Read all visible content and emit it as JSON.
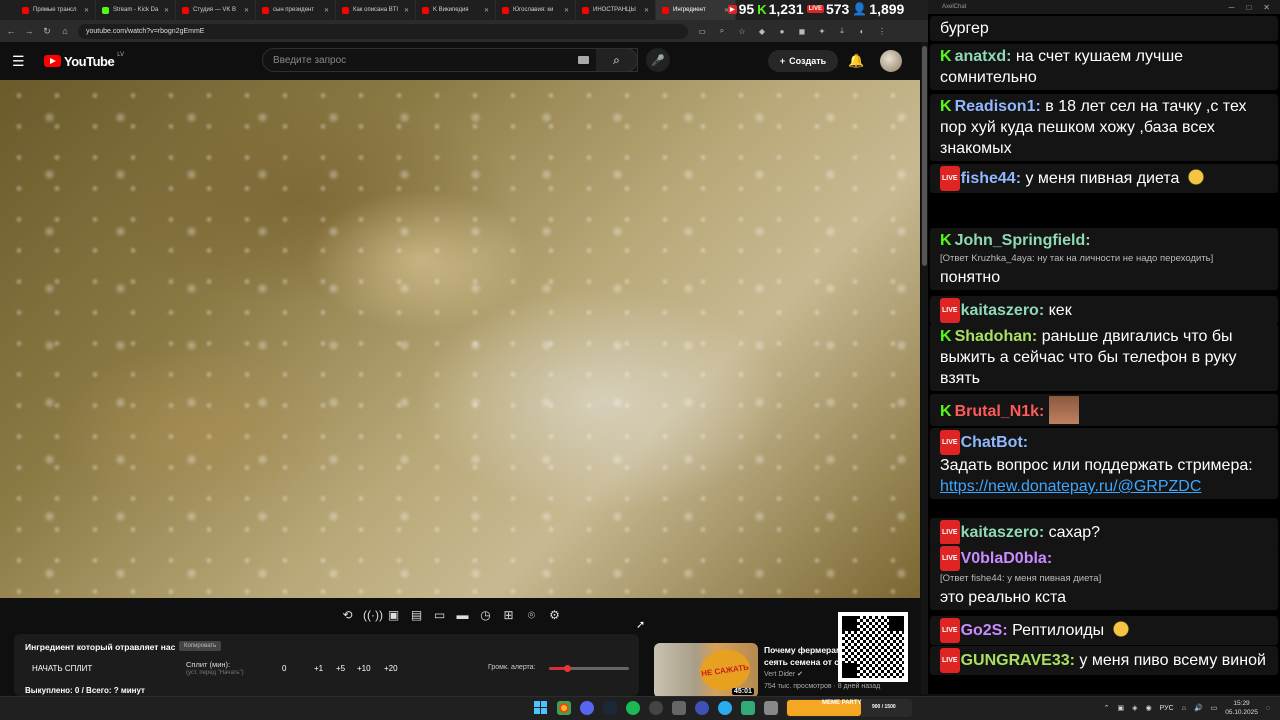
{
  "browser": {
    "tabs": [
      {
        "title": "Прямые трансл",
        "color": "#ff0000",
        "active": false
      },
      {
        "title": "Stream - Kick Da",
        "color": "#53fc18",
        "active": false
      },
      {
        "title": "Студия — VK B",
        "color": "#ff0000",
        "active": false
      },
      {
        "title": "сын президент",
        "color": "#ff0000",
        "active": false
      },
      {
        "title": "Как описана BTI",
        "color": "#ff0000",
        "active": false
      },
      {
        "title": "K Википедия",
        "color": "#ff0000",
        "active": false
      },
      {
        "title": "Югославия: ки",
        "color": "#ff0000",
        "active": false
      },
      {
        "title": "ИНОСТРАНЦЫ",
        "color": "#ff0000",
        "active": false
      },
      {
        "title": "Ингредиент",
        "color": "#ff0000",
        "active": true
      }
    ],
    "url": "youtube.com/watch?v=rbogn2gEmmE"
  },
  "counters": {
    "youtube": "95",
    "kick": "1,231",
    "vk": "573",
    "total": "1,899"
  },
  "youtube": {
    "logo_text": "YouTube",
    "region": "LV",
    "search_placeholder": "Введите запрос",
    "create_label": "Создать"
  },
  "split_panel": {
    "title": "Ингредиент который отравляет нас",
    "copy_label": "Копировать",
    "start_label": "НАЧАТЬ СПЛИТ",
    "split_label": "Сплит (мин):",
    "split_hint": "(уст. перед \"Начать\")",
    "split_value": "0",
    "increments": [
      "+1",
      "+5",
      "+10",
      "+20"
    ],
    "volume_label": "Громк. алерта:",
    "volume_level": 0.22,
    "bought": "Выкуплено: 0 / Всего: ? минут"
  },
  "recommendation": {
    "badge": "НЕ САЖАТЬ",
    "duration": "45:01",
    "title": "Почему фермерам сеять семена от с",
    "channel": "Vert Dider",
    "meta": "754 тыс. просмотров · 8 дней назад"
  },
  "chat": {
    "app_title": "AxelChat",
    "messages": [
      {
        "platform": "",
        "nick": "",
        "text": "бургер",
        "reply": "",
        "nick_color": "#ffffff"
      },
      {
        "platform": "kick",
        "nick": "anatxd:",
        "text": "на счет кушаем лучше сомнительно",
        "reply": "",
        "nick_color": "#8fd9b6"
      },
      {
        "platform": "kick",
        "nick": "Readison1:",
        "text": "в 18 лет сел на тачку ,с тех пор хуй куда пешком хожу ,база всех знакомых",
        "reply": "",
        "nick_color": "#8fb8ff"
      },
      {
        "platform": "vk",
        "nick": "fishe44:",
        "text": "у меня пивная диета",
        "reply": "",
        "nick_color": "#8fb8ff"
      },
      {
        "platform": "kick",
        "nick": "John_Springfield:",
        "text": "понятно",
        "reply": "[Ответ Kruzhka_4aya: ну так на личности не надо переходить]",
        "nick_color": "#8fd9b6"
      },
      {
        "platform": "vk",
        "nick": "kaitaszero:",
        "text": "кек",
        "reply": "",
        "nick_color": "#8fd9b6"
      },
      {
        "platform": "kick",
        "nick": "Shadohan:",
        "text": "раньше двигались что бы выжить а сейчас что бы телефон в руку взять",
        "reply": "",
        "nick_color": "#a8e060"
      },
      {
        "platform": "kick",
        "nick": "Brutal_N1k:",
        "text": "",
        "reply": "",
        "nick_color": "#ff5a5a"
      },
      {
        "platform": "vk",
        "nick": "ChatBot:",
        "text": "Задать вопрос или поддержать стримера:",
        "link": "https://new.donatepay.ru/@GRPZDC",
        "reply": "",
        "nick_color": "#8fb8ff"
      },
      {
        "platform": "vk",
        "nick": "kaitaszero:",
        "text": "сахар?",
        "reply": "",
        "nick_color": "#8fd9b6"
      },
      {
        "platform": "vk",
        "nick": "V0blaD0bla:",
        "text": "это реально кста",
        "reply": "[Ответ fishe44: у меня пивная диета]",
        "nick_color": "#c98bff"
      },
      {
        "platform": "vk",
        "nick": "Go2S:",
        "text": "Рептилоиды",
        "reply": "",
        "nick_color": "#c98bff"
      },
      {
        "platform": "vk",
        "nick": "GUNGRAVE33:",
        "text": "у меня пиво всему виной",
        "reply": "",
        "nick_color": "#a8e060"
      }
    ]
  },
  "taskbar": {
    "stream_label": "МЕМЕ PARTY",
    "stream_value": "900 / 1500",
    "stream_progress": 0.6,
    "lang": "РУС",
    "time": "15:29",
    "date": "05.10.2025"
  }
}
